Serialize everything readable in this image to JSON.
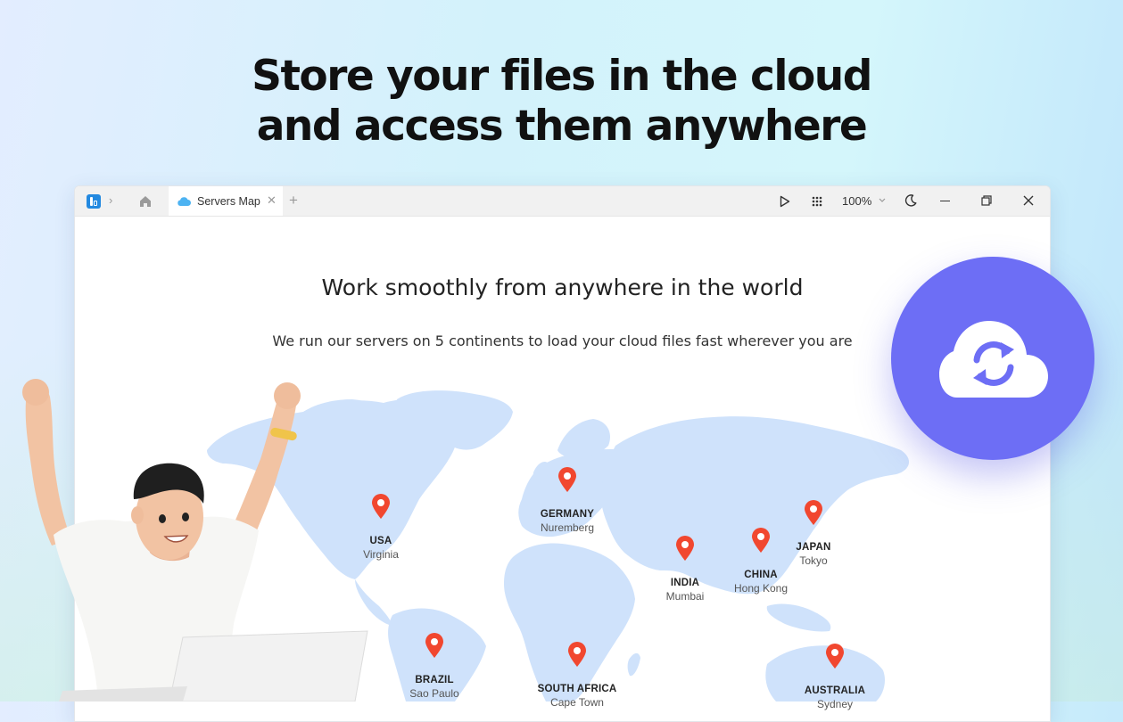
{
  "headline": {
    "line1": "Store your files in the cloud",
    "line2": "and access them anywhere"
  },
  "window": {
    "app_icon": "app-logo-icon",
    "breadcrumb_separator_icon": "chevron-right-icon",
    "home_icon": "home-icon",
    "tab": {
      "icon": "cloud-icon",
      "label": "Servers Map",
      "close_icon": "close-icon"
    },
    "new_tab_icon": "plus-icon",
    "toolbar": {
      "play_icon": "play-icon",
      "apps_icon": "grid-icon",
      "zoom_value": "100%",
      "zoom_chevron_icon": "chevron-down-icon",
      "theme_icon": "moon-icon",
      "minimize_icon": "minimize-icon",
      "restore_icon": "restore-icon",
      "close_icon": "close-icon"
    }
  },
  "content": {
    "title": "Work smoothly from anywhere in the world",
    "subtitle": "We run our servers on 5 continents to load your cloud files fast wherever you are"
  },
  "locations": [
    {
      "country": "USA",
      "city": "Virginia"
    },
    {
      "country": "GERMANY",
      "city": "Nuremberg"
    },
    {
      "country": "JAPAN",
      "city": "Tokyo"
    },
    {
      "country": "CHINA",
      "city": "Hong Kong"
    },
    {
      "country": "INDIA",
      "city": "Mumbai"
    },
    {
      "country": "BRAZIL",
      "city": "Sao Paulo"
    },
    {
      "country": "SOUTH AFRICA",
      "city": "Cape Town"
    },
    {
      "country": "AUSTRALIA",
      "city": "Sydney"
    }
  ],
  "badge": {
    "icon": "cloud-sync-icon",
    "color": "#6d6ef5"
  },
  "colors": {
    "pin": "#f1472f",
    "map": "#cfe2fb",
    "accent": "#2389e0"
  }
}
